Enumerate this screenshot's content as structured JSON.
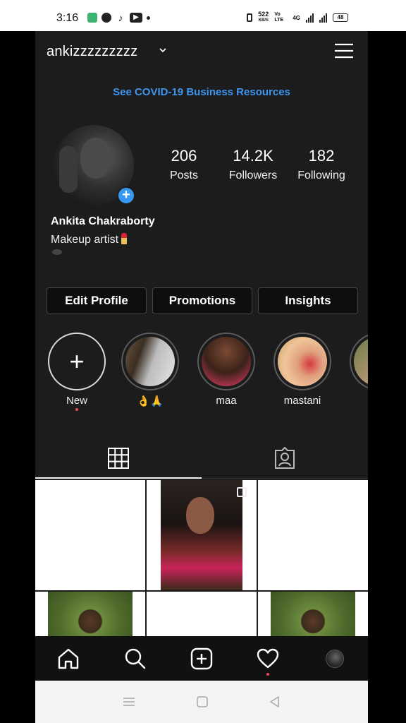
{
  "status_bar": {
    "time": "3:16",
    "speed_value": "522",
    "speed_unit": "KB/S",
    "network": "Vo LTE",
    "signal": "4G",
    "battery": "48"
  },
  "header": {
    "username": "ankizzzzzzzzz",
    "menu_icon": "hamburger-icon"
  },
  "banner": {
    "text": "See COVID-19 Business Resources",
    "color": "#3d95ef"
  },
  "profile": {
    "stats": [
      {
        "value": "206",
        "label": "Posts"
      },
      {
        "value": "14.2K",
        "label": "Followers"
      },
      {
        "value": "182",
        "label": "Following"
      }
    ],
    "name": "Ankita Chakraborty",
    "bio": "Makeup artist"
  },
  "actions": {
    "edit": "Edit Profile",
    "promotions": "Promotions",
    "insights": "Insights"
  },
  "highlights": [
    {
      "label": "New"
    },
    {
      "label": "👌🙏"
    },
    {
      "label": "maa"
    },
    {
      "label": "mastani"
    },
    {
      "label": ""
    }
  ],
  "tabs": {
    "grid_icon": "grid-icon",
    "tagged_icon": "tagged-icon"
  },
  "bottom_nav": [
    {
      "icon": "home-icon"
    },
    {
      "icon": "search-icon"
    },
    {
      "icon": "add-post-icon"
    },
    {
      "icon": "heart-icon"
    },
    {
      "icon": "profile-avatar-icon"
    }
  ],
  "colors": {
    "accent": "#3897f0",
    "notification": "#ed4956",
    "background": "#1c1c1c"
  }
}
